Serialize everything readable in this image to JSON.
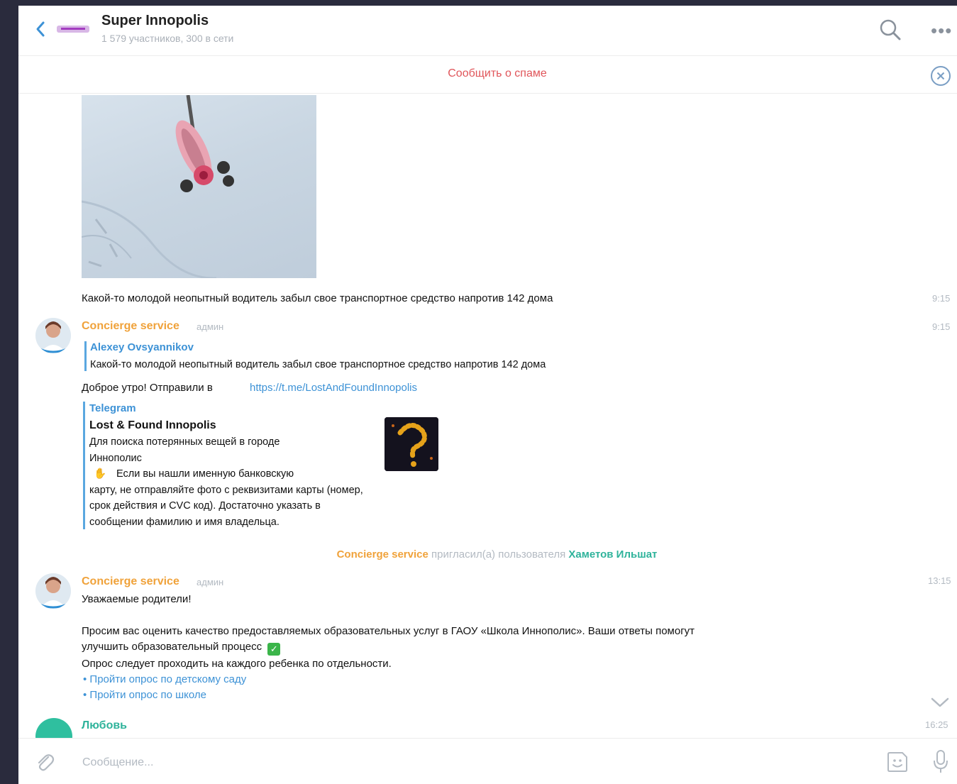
{
  "header": {
    "title": "Super Innopolis",
    "subtitle": "1 579 участников, 300 в сети"
  },
  "spam_bar": {
    "label": "Сообщить о спаме"
  },
  "messages": [
    {
      "text": "Какой-то молодой неопытный водитель забыл свое транспортное средство напротив 142 дома",
      "time": "9:15"
    },
    {
      "author": "Concierge service",
      "role": "админ",
      "time": "9:15",
      "reply": {
        "name": "Alexey Ovsyannikov",
        "text": "Какой-то молодой неопытный водитель забыл свое транспортное средство напротив 142 дома"
      },
      "text": "Доброе утро! Отправили в ",
      "link": "https://t.me/LostAndFoundInnopolis",
      "preview": {
        "site": "Telegram",
        "title": "Lost & Found Innopolis",
        "line1": "Для поиска потерянных вещей в городе",
        "line2": "Иннополис",
        "line3": "Если вы нашли именную банковскую",
        "line4": "карту, не отправляйте фото с реквизитами карты (номер,",
        "line5": "срок действия и CVC код). Достаточно указать в",
        "line6": "сообщении фамилию и имя владельца."
      }
    }
  ],
  "service_message": {
    "actor": "Concierge service",
    "action": " пригласил(а) пользователя ",
    "target": "Хаметов Ильшат"
  },
  "message3": {
    "author": "Concierge service",
    "role": "админ",
    "time": "13:15",
    "line1": "Уважаемые родители!",
    "line2": "Просим вас оценить качество предоставляемых образовательных услуг в ГАОУ «Школа Иннополис». Ваши ответы помогут",
    "line3": "улучшить образовательный процесс",
    "line4": "Опрос следует проходить на каждого ребенка по отдельности.",
    "bullet1": "Пройти опрос по детскому саду",
    "bullet2": "Пройти опрос по школе"
  },
  "message4": {
    "author": "Любовь",
    "time": "16:25"
  },
  "composer": {
    "placeholder": "Сообщение..."
  },
  "colors": {
    "admin_name": "#f0a23a",
    "link": "#3d92d6",
    "spam": "#e0555a",
    "join_name": "#2fb39b"
  },
  "icons": [
    "back-icon",
    "search-icon",
    "more-icon",
    "close-icon",
    "attach-icon",
    "sticker-icon",
    "microphone-icon",
    "chevron-down-icon",
    "checkmark-icon",
    "hand-emoji-icon"
  ]
}
